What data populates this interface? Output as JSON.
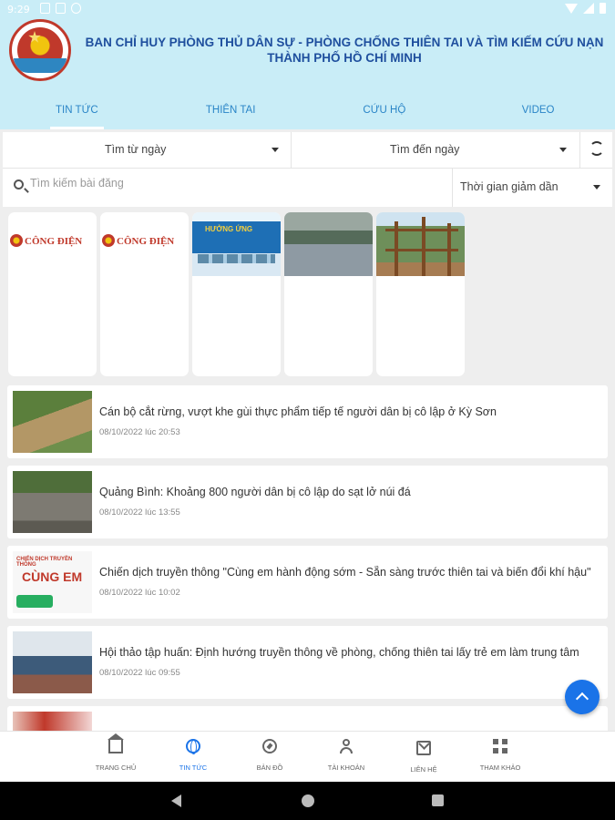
{
  "status_bar": {
    "time": "9:29"
  },
  "header": {
    "title_line1": "BAN CHỈ HUY PHÒNG THỦ DÂN SỰ - PHÒNG CHỐNG THIÊN TAI VÀ TÌM KIẾM CỨU NẠN",
    "title_line2": "THÀNH PHỐ HỒ CHÍ MINH"
  },
  "tabs": [
    {
      "label": "TIN TỨC",
      "active": true
    },
    {
      "label": "THIÊN TAI"
    },
    {
      "label": "CỨU HỘ"
    },
    {
      "label": "VIDEO"
    }
  ],
  "filters": {
    "from_date": "Tìm từ ngày",
    "to_date": "Tìm đến ngày",
    "search_placeholder": "Tìm kiếm bài đăng",
    "sort": "Thời gian giảm dần"
  },
  "cards": [
    {
      "label": "CÔNG ĐIỆN",
      "type": "cong-dien"
    },
    {
      "label": "CÔNG ĐIỆN",
      "type": "cong-dien"
    },
    {
      "label": "HƯỞNG ỨNG",
      "type": "poster"
    },
    {
      "label": "",
      "type": "flood"
    },
    {
      "label": "",
      "type": "frame"
    }
  ],
  "news": [
    {
      "title": "Cán bộ cắt rừng, vượt khe gùi thực phẩm tiếp tế người dân bị cô lập ở Kỳ Sơn",
      "date": "08/10/2022 lúc 20:53"
    },
    {
      "title": "Quảng Bình: Khoảng 800 người dân bị cô lập do sạt lở núi đá",
      "date": "08/10/2022 lúc 13:55"
    },
    {
      "title": "Chiến dịch truyền thông \"Cùng em hành động sớm - Sẵn sàng trước thiên tai và biến đổi khí hậu\"",
      "date": "08/10/2022 lúc 10:02"
    },
    {
      "title": "Hội thảo tập huấn: Định hướng truyền thông về phòng, chống thiên tai lấy trẻ em làm trung tâm",
      "date": "08/10/2022 lúc 09:55"
    }
  ],
  "news_img3_text": {
    "small": "CHIẾN DỊCH TRUYỀN THÔNG",
    "big": "CÙNG EM"
  },
  "bottom_nav": [
    {
      "label": "TRANG CHỦ",
      "icon": "home-icon"
    },
    {
      "label": "TIN TỨC",
      "icon": "globe-icon",
      "active": true
    },
    {
      "label": "BẢN ĐỒ",
      "icon": "compass-icon"
    },
    {
      "label": "TÀI KHOẢN",
      "icon": "person-icon"
    },
    {
      "label": "LIÊN HỆ",
      "icon": "mail-icon"
    },
    {
      "label": "THAM KHẢO",
      "icon": "qr-grid-icon"
    }
  ],
  "colors": {
    "header_bg": "#c9edf7",
    "tab_text": "#2a85c7",
    "title": "#1f4f9e",
    "accent": "#1a73e8"
  }
}
